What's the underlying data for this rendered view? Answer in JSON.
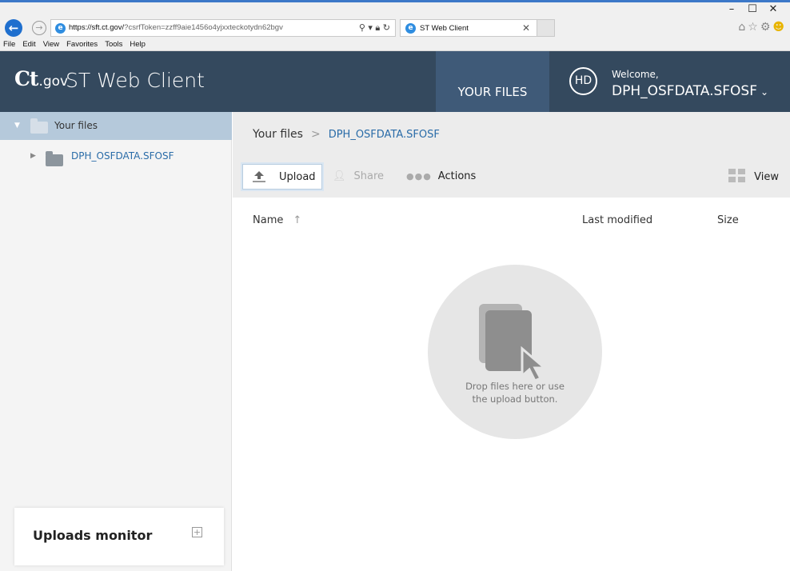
{
  "browser": {
    "url_prefix": "https://sft.ct.gov/",
    "url_rest": "?csrfToken=zzff9aie1456o4yjxxteckotydn62bgv",
    "tab_title": "ST Web Client",
    "menu": [
      "File",
      "Edit",
      "View",
      "Favorites",
      "Tools",
      "Help"
    ],
    "window_controls": [
      "–",
      "☐",
      "✕"
    ]
  },
  "header": {
    "logo_ct": "Ct",
    "logo_gov": ".gov",
    "app_title": "ST Web Client",
    "nav_tab": "YOUR FILES",
    "avatar_initials": "HD",
    "welcome": "Welcome,",
    "username": "DPH_OSFDATA.SFOSF"
  },
  "sidebar": {
    "root_label": "Your files",
    "child_label": "DPH_OSFDATA.SFOSF",
    "uploads_monitor": "Uploads monitor"
  },
  "main": {
    "breadcrumb_root": "Your files",
    "breadcrumb_current": "DPH_OSFDATA.SFOSF",
    "toolbar": {
      "upload": "Upload",
      "share": "Share",
      "actions": "Actions",
      "view": "View"
    },
    "columns": {
      "name": "Name",
      "sort_indicator": "↑",
      "last_modified": "Last modified",
      "size": "Size"
    },
    "dropzone_line1": "Drop files here or use",
    "dropzone_line2": "the upload button."
  },
  "colors": {
    "header_bg": "#34495e",
    "active_tab_bg": "#3f5a78",
    "link_blue": "#2a6ca8",
    "sidebar_selected": "#b5c9db"
  }
}
